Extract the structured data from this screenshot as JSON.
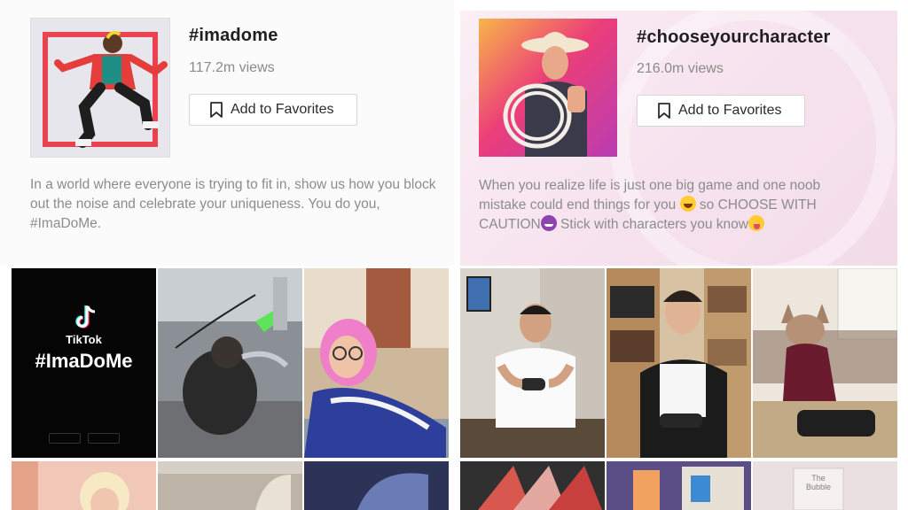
{
  "cards": [
    {
      "title": "#imadome",
      "views": "117.2m views",
      "favorite_label": "Add to Favorites",
      "description": "In a world where everyone is trying to fit in, show us how you block out the noise and celebrate your uniqueness. You do you, #ImaDoMe."
    },
    {
      "title": "#chooseyourcharacter",
      "views": "216.0m views",
      "favorite_label": "Add to Favorites",
      "description_parts": [
        "When you realize life is just one big game and one noob mistake could end things for you ",
        " so CHOOSE WITH CAUTION",
        " Stick with characters you know"
      ]
    }
  ],
  "tiles": {
    "brand_name": "TikTok",
    "hashtag": "#ImaDoMe",
    "sign_text": "The Bubble"
  },
  "colors": {
    "accent_red": "#e8434f",
    "tiktok_cyan": "#25f4ee",
    "tiktok_pink": "#fe2c55"
  }
}
